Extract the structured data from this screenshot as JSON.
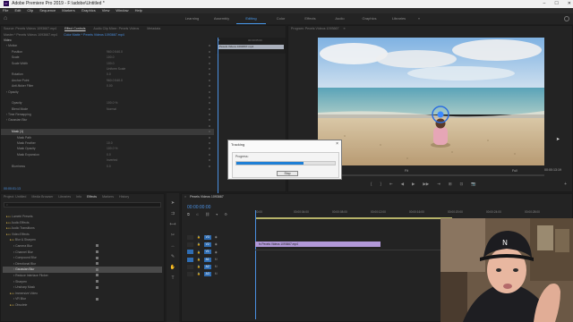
{
  "window": {
    "title": "Adobe Premiere Pro 2019 - F:\\adobe\\Untitled *",
    "controls": [
      "–",
      "☐",
      "✕"
    ]
  },
  "menu": [
    "File",
    "Edit",
    "Clip",
    "Sequence",
    "Markers",
    "Graphics",
    "View",
    "Window",
    "Help"
  ],
  "workspaces": {
    "tabs": [
      "Learning",
      "Assembly",
      "Editing",
      "Color",
      "Effects",
      "Audio",
      "Graphics",
      "Libraries"
    ],
    "active": 2,
    "more": "»"
  },
  "effect_controls": {
    "tabs": [
      "Source: Pexels Videos 1093667.mp4",
      "Effect Controls",
      "Audio Clip Mixer: Pexels Videos",
      "Metadata"
    ],
    "active_tab": "Effect Controls",
    "master": "Master * Pexels Videos 1093667.mp4",
    "clip": "Color Matte * Pexels Videos 1093667.mp4",
    "section": "Video",
    "mini_clip": "Pexels Videos 1093667.mp4",
    "mini_timecode": "00:00:05:00",
    "rows": [
      {
        "label": "Motion",
        "value": "",
        "indent": 2
      },
      {
        "label": "Position",
        "value": "960.0    540.0",
        "indent": 4
      },
      {
        "label": "Scale",
        "value": "100.0",
        "indent": 4
      },
      {
        "label": "Scale Width",
        "value": "100.0",
        "indent": 4
      },
      {
        "label": "",
        "value": "Uniform Scale",
        "indent": 4
      },
      {
        "label": "Rotation",
        "value": "0.0",
        "indent": 4
      },
      {
        "label": "Anchor Point",
        "value": "960.0    540.0",
        "indent": 4
      },
      {
        "label": "Anti-flicker Filter",
        "value": "0.00",
        "indent": 4
      },
      {
        "label": "Opacity",
        "value": "",
        "indent": 2
      },
      {
        "label": "",
        "value": "",
        "indent": 4
      },
      {
        "label": "Opacity",
        "value": "100.0 %",
        "indent": 4
      },
      {
        "label": "Blend Mode",
        "value": "Normal",
        "indent": 4
      },
      {
        "label": "Time Remapping",
        "value": "",
        "indent": 2
      },
      {
        "label": "Gaussian Blur",
        "value": "",
        "indent": 2
      },
      {
        "label": "",
        "value": "",
        "indent": 4
      },
      {
        "label": "Mask (1)",
        "value": "",
        "indent": 4,
        "highlight": true
      },
      {
        "label": "Mask Path",
        "value": "",
        "indent": 6
      },
      {
        "label": "Mask Feather",
        "value": "10.0",
        "indent": 6
      },
      {
        "label": "Mask Opacity",
        "value": "100.0 %",
        "indent": 6
      },
      {
        "label": "Mask Expansion",
        "value": "0.0",
        "indent": 6
      },
      {
        "label": "",
        "value": "Inverted",
        "indent": 6
      },
      {
        "label": "Blurriness",
        "value": "0.0",
        "indent": 4
      }
    ],
    "timecode": "00:00:01:13"
  },
  "program_monitor": {
    "tabs": [
      "Program: Pexels Videos 1093667",
      "≡"
    ],
    "timecode_left": "00:00:01:13",
    "fit": "Fit",
    "quality": "Full",
    "timecode_right": "00:00:13:19",
    "controls": [
      "⇤",
      "{",
      "}",
      "⇥",
      "◀",
      "▶",
      "▶▶",
      "⇥",
      "⊞",
      "⊡",
      "📷",
      "+"
    ]
  },
  "tracking_dialog": {
    "title": "Tracking",
    "progress_label": "Progress:",
    "progress": 0.68,
    "stop": "Stop"
  },
  "effects_panel": {
    "tabs": [
      "Project: Untitled",
      "Media Browser",
      "Libraries",
      "Info",
      "Effects",
      "Markers",
      "History"
    ],
    "active_tab": "Effects",
    "search": "",
    "items": [
      {
        "label": "Lumetri Presets",
        "indent": 1
      },
      {
        "label": "Audio Effects",
        "indent": 1
      },
      {
        "label": "Audio Transitions",
        "indent": 1
      },
      {
        "label": "Video Effects",
        "indent": 1
      },
      {
        "label": "Blur & Sharpen",
        "indent": 2
      },
      {
        "label": "Camera Blur",
        "indent": 3
      },
      {
        "label": "Channel Blur",
        "indent": 3
      },
      {
        "label": "Compound Blur",
        "indent": 3
      },
      {
        "label": "Directional Blur",
        "indent": 3
      },
      {
        "label": "Gaussian Blur",
        "indent": 3,
        "selected": true
      },
      {
        "label": "Reduce Interlace Flicker",
        "indent": 3
      },
      {
        "label": "Sharpen",
        "indent": 3
      },
      {
        "label": "Unsharp Mask",
        "indent": 3
      },
      {
        "label": "Immersive Video",
        "indent": 2
      },
      {
        "label": "VR Blur",
        "indent": 3
      },
      {
        "label": "Obsolete",
        "indent": 2
      }
    ]
  },
  "timeline": {
    "tab": "Pexels Videos 1093667",
    "timecode": "00:00:00:00",
    "ruler": [
      "00:00",
      "00:00:04:00",
      "00:00:08:00",
      "00:00:12:00",
      "00:00:16:00",
      "00:00:20:00",
      "00:00:24:00",
      "00:00:28:00"
    ],
    "tracks": [
      "V3",
      "V2",
      "V1",
      "A1",
      "A2",
      "A3"
    ],
    "clip_label": "fx  Pexels Videos 1093667.mp4"
  },
  "colors": {
    "accent": "#4a9cf0",
    "clip": "#b198d8",
    "progress": "#1e7fd6"
  }
}
